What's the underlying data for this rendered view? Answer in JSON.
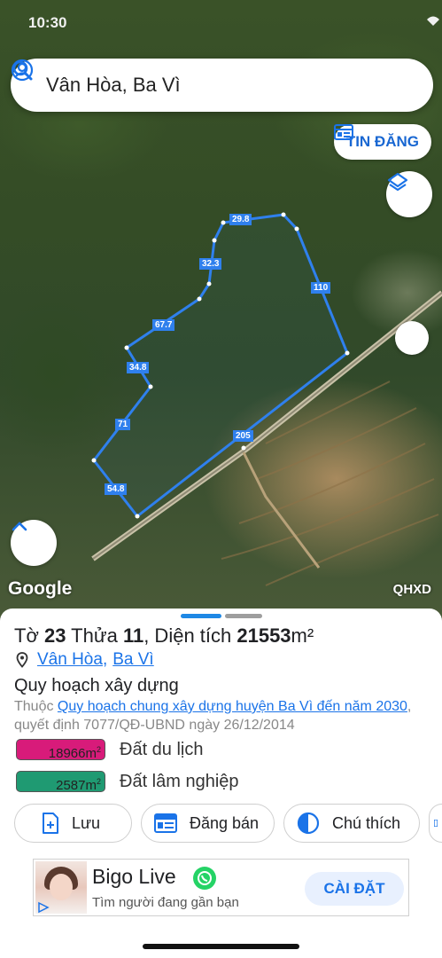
{
  "status_bar": {
    "time": "10:30"
  },
  "search": {
    "query": "Vân Hòa, Ba Vì"
  },
  "map": {
    "tin_dang_label": "TIN ĐĂNG",
    "attribution": "Google",
    "layer_label": "QHXD",
    "edge_labels": [
      "29.8",
      "110",
      "32.3",
      "67.7",
      "34.8",
      "71",
      "205",
      "54.8"
    ]
  },
  "parcel": {
    "title_prefix": "Tờ ",
    "sheet": "23",
    "parcel_word": " Thửa ",
    "parcel_no": "11",
    "area_word": ", Diện tích ",
    "area": "21553",
    "area_unit": "m²",
    "commune": "Vân Hòa",
    "separator": ",",
    "district": "Ba Vì"
  },
  "planning": {
    "section_title": "Quy hoạch xây dựng",
    "prefix": "Thuộc ",
    "plan_link": "Quy hoạch chung xây dựng huyện Ba Vì đến năm 2030",
    "suffix": ", quyết định 7077/QĐ-UBND ngày 26/12/2014"
  },
  "legend": [
    {
      "value": "18966m",
      "unit": "2",
      "label": "Đất du lịch",
      "color": "#d81b7a"
    },
    {
      "value": "2587m",
      "unit": "2",
      "label": "Đất lâm nghiệp",
      "color": "#1f9a72"
    }
  ],
  "actions": {
    "save": "Lưu",
    "post": "Đăng bán",
    "legend": "Chú thích"
  },
  "ad": {
    "app_name": "Bigo Live",
    "tagline": "Tìm người đang gần bạn",
    "install": "CÀI ĐẶT"
  },
  "colors": {
    "accent": "#1a73e8",
    "boundary": "#2f80ed"
  }
}
